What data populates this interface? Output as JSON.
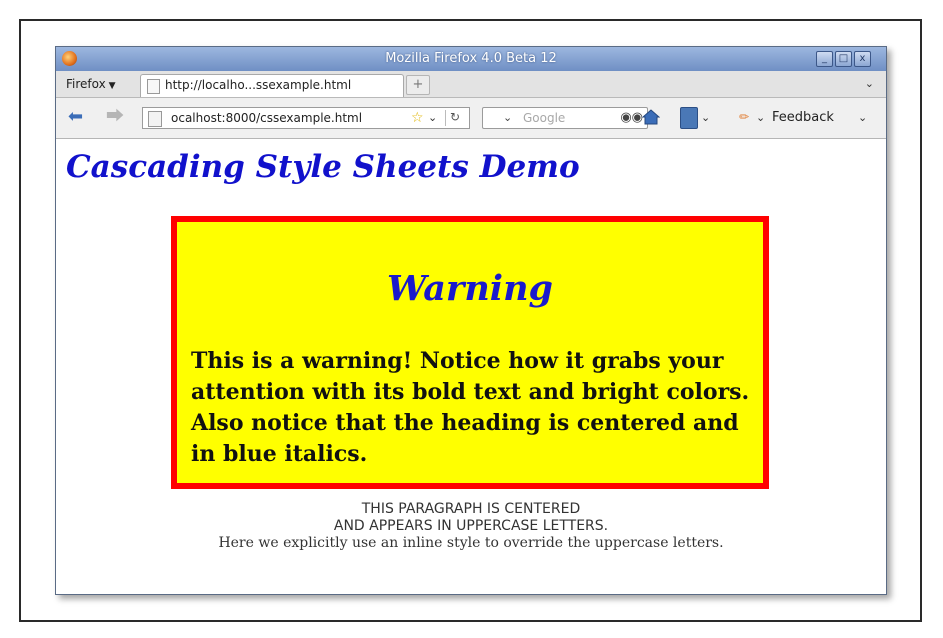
{
  "window": {
    "title": "Mozilla Firefox 4.0 Beta 12",
    "controls": {
      "minimize": "_",
      "maximize": "□",
      "close": "x"
    }
  },
  "tabbar": {
    "firefox_menu": "Firefox",
    "tab_label": "http://localho...ssexample.html",
    "new_tab": "+",
    "tab_list": "⌄"
  },
  "navbar": {
    "url": "ocalhost:8000/cssexample.html",
    "search_placeholder": "Google",
    "feedback_label": "Feedback"
  },
  "page": {
    "title": "Cascading Style Sheets Demo",
    "warning": {
      "heading": "Warning",
      "text": "This is a warning! Notice how it grabs your attention with its bold text and bright colors. Also notice that the heading is centered and in blue italics."
    },
    "centered_paragraph": {
      "line1": "This paragraph is centered",
      "line2": "and appears in uppercase letters.",
      "line3": "Here we explicitly use an inline style to override the uppercase letters."
    }
  },
  "colors": {
    "title_blue": "#1111cc",
    "warning_bg": "#ffff00",
    "warning_border": "#ff0000"
  },
  "icons": [
    "firefox-logo-icon",
    "page-icon",
    "back-arrow-icon",
    "forward-arrow-icon",
    "star-icon",
    "reload-icon",
    "binoculars-icon",
    "home-icon",
    "bookmark-icon",
    "feedback-icon"
  ]
}
